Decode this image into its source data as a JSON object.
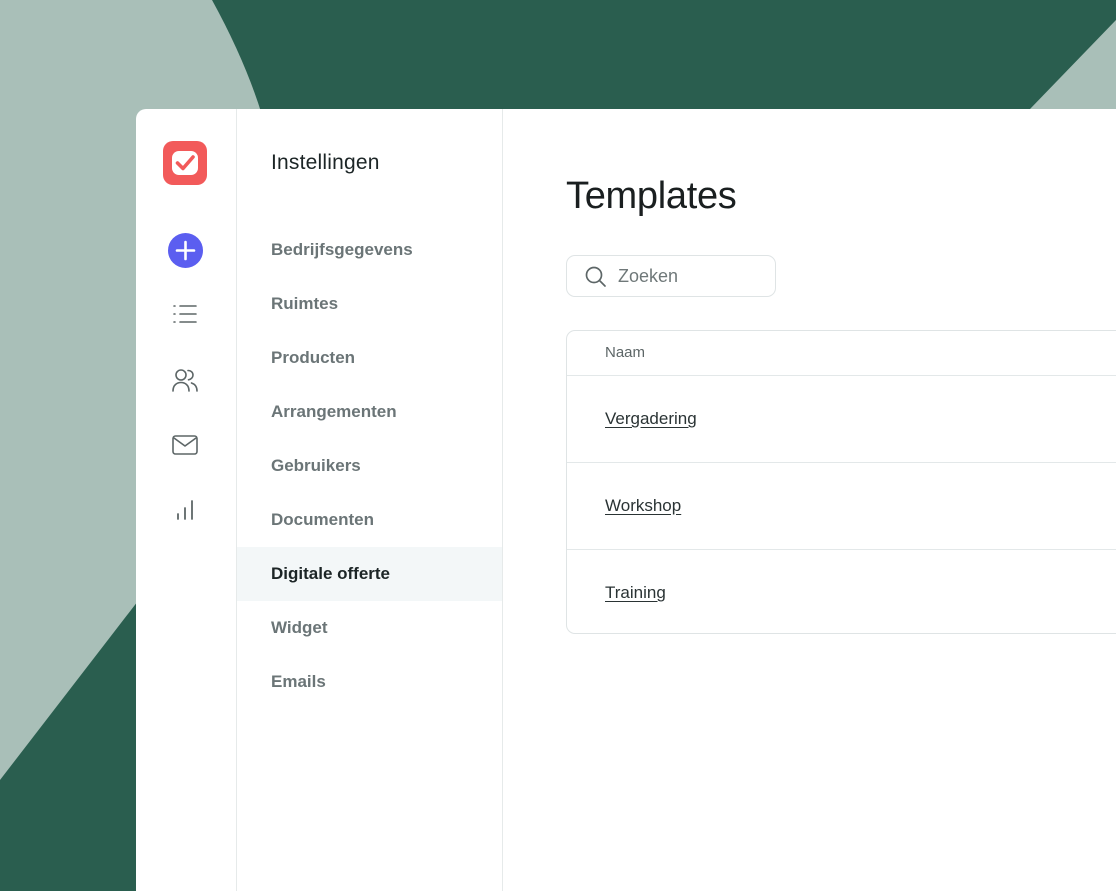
{
  "sidebar_title": "Instellingen",
  "menu": [
    {
      "label": "Bedrijfsgegevens",
      "active": false
    },
    {
      "label": "Ruimtes",
      "active": false
    },
    {
      "label": "Producten",
      "active": false
    },
    {
      "label": "Arrangementen",
      "active": false
    },
    {
      "label": "Gebruikers",
      "active": false
    },
    {
      "label": "Documenten",
      "active": false
    },
    {
      "label": "Digitale offerte",
      "active": true
    },
    {
      "label": "Widget",
      "active": false
    },
    {
      "label": "Emails",
      "active": false
    }
  ],
  "rail_icons": [
    "logo-icon",
    "add-icon",
    "list-icon",
    "users-icon",
    "mail-icon",
    "chart-icon"
  ],
  "main": {
    "title": "Templates",
    "search": {
      "placeholder": "Zoeken",
      "value": ""
    },
    "table": {
      "header": "Naam",
      "rows": [
        "Vergadering",
        "Workshop",
        "Training"
      ]
    }
  },
  "colors": {
    "background_dark": "#2a5e4f",
    "background_light": "#a9bfb8",
    "logo": "#f25a5a",
    "add_button": "#5b5ef0",
    "active_item_bg": "#f3f7f8"
  }
}
